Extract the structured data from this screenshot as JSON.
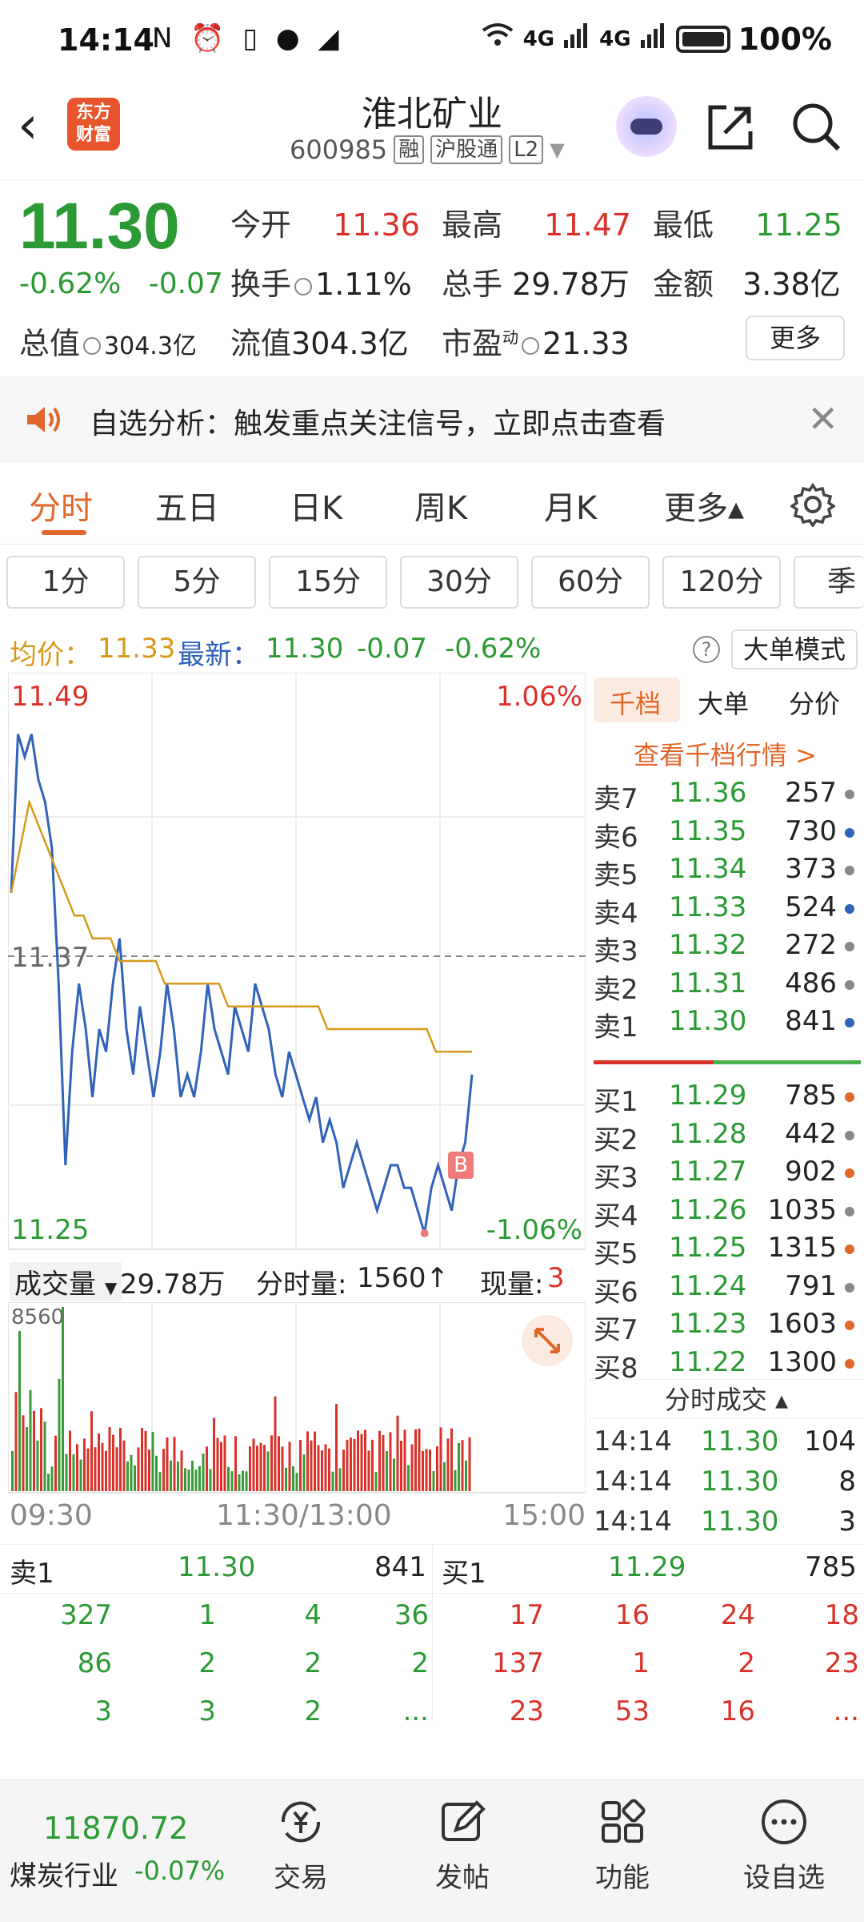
{
  "status_bar": {
    "time": "14:14",
    "left_icons": "N ⏰ ▯ ● ◢",
    "net1": "4G",
    "net2": "4G",
    "battery": "100%"
  },
  "header": {
    "back": "‹",
    "logo_line1": "东方",
    "logo_line2": "财富",
    "title": "淮北矿业",
    "code": "600985",
    "tag1": "融",
    "tag2": "沪股通",
    "tag3": "L2"
  },
  "quote": {
    "price": "11.30",
    "pct_change": "-0.62%",
    "abs_change": "-0.07",
    "open_label": "今开",
    "open": "11.36",
    "high_label": "最高",
    "high": "11.47",
    "low_label": "最低",
    "low": "11.25",
    "turnover_label": "换手",
    "turnover": "1.11%",
    "volume_label": "总手",
    "volume": "29.78万",
    "amount_label": "金额",
    "amount": "3.38亿",
    "mktcap_label": "总值",
    "mktcap": "304.3亿",
    "float_label": "流值",
    "float_cap": "304.3亿",
    "pe_label": "市盈",
    "pe_sup": "动",
    "pe": "21.33",
    "more": "更多"
  },
  "alert": {
    "text": "自选分析：触发重点关注信号，立即点击查看",
    "close": "✕"
  },
  "tabs": [
    "分时",
    "五日",
    "日K",
    "周K",
    "月K",
    "更多▴"
  ],
  "periods": [
    "1分",
    "5分",
    "15分",
    "30分",
    "60分",
    "120分",
    "季"
  ],
  "avg_info": {
    "avg_label": "均价：",
    "avg": "11.33",
    "latest_label": "最新：",
    "latest": "11.30",
    "chg": "-0.07",
    "pct": "-0.62%",
    "help": "?",
    "big_mode": "大单模式"
  },
  "chart_labels": {
    "top_price": "11.49",
    "top_pct": "1.06%",
    "mid_price": "11.37",
    "bottom_price": "11.25",
    "bottom_pct": "-1.06%",
    "b_marker": "B",
    "vol_label": "成交量",
    "vol_total": "29.78万",
    "minute_vol_label": "分时量:",
    "minute_vol": "1560↑",
    "now_vol_label": "现量:",
    "now_vol": "3",
    "vol_max": "8560",
    "t_start": "09:30",
    "t_mid": "11:30/13:00",
    "t_end": "15:00"
  },
  "chart_data": {
    "type": "line",
    "price_range": [
      11.25,
      11.49
    ],
    "prev_close": 11.37,
    "price_series": [
      11.4,
      11.47,
      11.46,
      11.47,
      11.45,
      11.44,
      11.42,
      11.36,
      11.28,
      11.33,
      11.36,
      11.34,
      11.31,
      11.34,
      11.33,
      11.36,
      11.38,
      11.34,
      11.32,
      11.35,
      11.33,
      11.31,
      11.33,
      11.36,
      11.34,
      11.31,
      11.32,
      11.31,
      11.33,
      11.36,
      11.34,
      11.33,
      11.32,
      11.35,
      11.34,
      11.33,
      11.36,
      11.35,
      11.34,
      11.32,
      11.31,
      11.33,
      11.32,
      11.31,
      11.3,
      11.31,
      11.29,
      11.3,
      11.29,
      11.27,
      11.28,
      11.29,
      11.28,
      11.27,
      11.26,
      11.27,
      11.28,
      11.28,
      11.27,
      11.27,
      11.26,
      11.25,
      11.27,
      11.28,
      11.27,
      11.26,
      11.28,
      11.29,
      11.32
    ],
    "avg_series": [
      11.4,
      11.42,
      11.44,
      11.43,
      11.42,
      11.41,
      11.4,
      11.39,
      11.39,
      11.38,
      11.38,
      11.38,
      11.37,
      11.37,
      11.37,
      11.37,
      11.37,
      11.36,
      11.36,
      11.36,
      11.36,
      11.36,
      11.36,
      11.36,
      11.35,
      11.35,
      11.35,
      11.35,
      11.35,
      11.35,
      11.35,
      11.35,
      11.35,
      11.35,
      11.35,
      11.34,
      11.34,
      11.34,
      11.34,
      11.34,
      11.34,
      11.34,
      11.34,
      11.34,
      11.34,
      11.34,
      11.34,
      11.33,
      11.33,
      11.33,
      11.33,
      11.33
    ],
    "volume_max": 8560
  },
  "book": {
    "tabs": [
      "千档",
      "大单",
      "分价"
    ],
    "link": "查看千档行情 >",
    "asks": [
      {
        "k": "卖7",
        "p": "11.36",
        "v": "257"
      },
      {
        "k": "卖6",
        "p": "11.35",
        "v": "730"
      },
      {
        "k": "卖5",
        "p": "11.34",
        "v": "373"
      },
      {
        "k": "卖4",
        "p": "11.33",
        "v": "524"
      },
      {
        "k": "卖3",
        "p": "11.32",
        "v": "272"
      },
      {
        "k": "卖2",
        "p": "11.31",
        "v": "486"
      },
      {
        "k": "卖1",
        "p": "11.30",
        "v": "841"
      }
    ],
    "bids": [
      {
        "k": "买1",
        "p": "11.29",
        "v": "785"
      },
      {
        "k": "买2",
        "p": "11.28",
        "v": "442"
      },
      {
        "k": "买3",
        "p": "11.27",
        "v": "902"
      },
      {
        "k": "买4",
        "p": "11.26",
        "v": "1035"
      },
      {
        "k": "买5",
        "p": "11.25",
        "v": "1315"
      },
      {
        "k": "买6",
        "p": "11.24",
        "v": "791"
      },
      {
        "k": "买7",
        "p": "11.23",
        "v": "1603"
      },
      {
        "k": "买8",
        "p": "11.22",
        "v": "1300"
      }
    ],
    "ticks_title": "分时成交 ▴",
    "ticks": [
      {
        "t": "14:14",
        "p": "11.30",
        "v": "104"
      },
      {
        "t": "14:14",
        "p": "11.30",
        "v": "8"
      },
      {
        "t": "14:14",
        "p": "11.30",
        "v": "3"
      }
    ]
  },
  "lower": {
    "sell_label": "卖1",
    "sell_price": "11.30",
    "sell_vol": "841",
    "buy_label": "买1",
    "buy_price": "11.29",
    "buy_vol": "785",
    "sell_rows": [
      [
        "327",
        "1",
        "4",
        "36"
      ],
      [
        "86",
        "2",
        "2",
        "2"
      ],
      [
        "3",
        "3",
        "2",
        "..."
      ]
    ],
    "buy_rows": [
      [
        "17",
        "16",
        "24",
        "18"
      ],
      [
        "137",
        "1",
        "2",
        "23"
      ],
      [
        "23",
        "53",
        "16",
        "..."
      ]
    ]
  },
  "bottom": {
    "index_value": "11870.72",
    "index_name": "煤炭行业",
    "index_chg": "-0.07%",
    "items": [
      "交易",
      "发帖",
      "功能",
      "设自选"
    ]
  }
}
